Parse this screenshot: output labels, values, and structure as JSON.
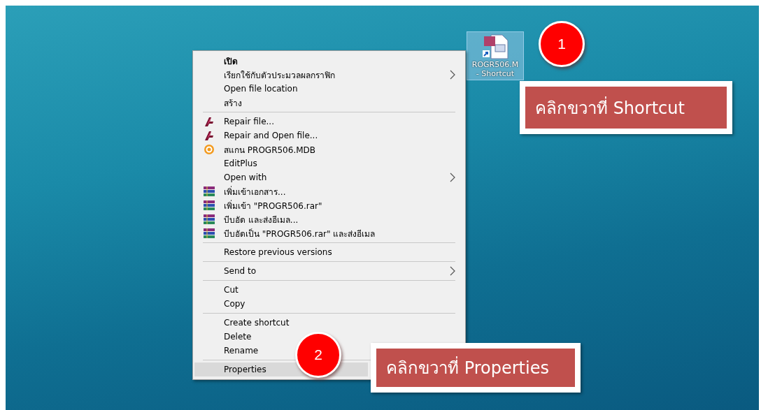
{
  "desktop_icon": {
    "lines": [
      "ROGR506.M",
      "- Shortcut"
    ],
    "selected": true
  },
  "context_menu": {
    "items": [
      {
        "kind": "item",
        "label": "เปิด",
        "default": true,
        "submenu": false,
        "selected": false
      },
      {
        "kind": "item",
        "label": "เรียกใช้กับตัวประมวลผลกราฟิก",
        "default": false,
        "submenu": true,
        "selected": false
      },
      {
        "kind": "item",
        "label": "Open file location",
        "default": false,
        "submenu": false,
        "selected": false
      },
      {
        "kind": "item",
        "label": "สร้าง",
        "default": false,
        "submenu": false,
        "selected": false
      },
      {
        "kind": "separator"
      },
      {
        "kind": "repair",
        "label": "Repair file...",
        "default": false,
        "submenu": false,
        "selected": false
      },
      {
        "kind": "repair",
        "label": "Repair and Open file...",
        "default": false,
        "submenu": false,
        "selected": false
      },
      {
        "kind": "scan",
        "label": "สแกน PROGR506.MDB",
        "default": false,
        "submenu": false,
        "selected": false
      },
      {
        "kind": "item",
        "label": "EditPlus",
        "default": false,
        "submenu": false,
        "selected": false
      },
      {
        "kind": "item",
        "label": "Open with",
        "default": false,
        "submenu": true,
        "selected": false
      },
      {
        "kind": "archive",
        "label": "เพิ่มเข้าเอกสาร...",
        "default": false,
        "submenu": false,
        "selected": false
      },
      {
        "kind": "archive",
        "label": "เพิ่มเข้า \"PROGR506.rar\"",
        "default": false,
        "submenu": false,
        "selected": false
      },
      {
        "kind": "archive",
        "label": "บีบอัด และส่งอีเมล...",
        "default": false,
        "submenu": false,
        "selected": false
      },
      {
        "kind": "archive",
        "label": "บีบอัดเป็น \"PROGR506.rar\" และส่งอีเมล",
        "default": false,
        "submenu": false,
        "selected": false
      },
      {
        "kind": "separator"
      },
      {
        "kind": "item",
        "label": "Restore previous versions",
        "default": false,
        "submenu": false,
        "selected": false
      },
      {
        "kind": "separator"
      },
      {
        "kind": "item",
        "label": "Send to",
        "default": false,
        "submenu": true,
        "selected": false
      },
      {
        "kind": "separator"
      },
      {
        "kind": "item",
        "label": "Cut",
        "default": false,
        "submenu": false,
        "selected": false
      },
      {
        "kind": "item",
        "label": "Copy",
        "default": false,
        "submenu": false,
        "selected": false
      },
      {
        "kind": "separator"
      },
      {
        "kind": "item",
        "label": "Create shortcut",
        "default": false,
        "submenu": false,
        "selected": false
      },
      {
        "kind": "item",
        "label": "Delete",
        "default": false,
        "submenu": false,
        "selected": false
      },
      {
        "kind": "item",
        "label": "Rename",
        "default": false,
        "submenu": false,
        "selected": false
      },
      {
        "kind": "separator"
      },
      {
        "kind": "item",
        "label": "Properties",
        "default": false,
        "submenu": false,
        "selected": true
      }
    ]
  },
  "annotations": [
    {
      "number": "1",
      "text": "คลิกขวาที่ Shortcut"
    },
    {
      "number": "2",
      "text": "คลิกขวาที่ Properties"
    }
  ]
}
